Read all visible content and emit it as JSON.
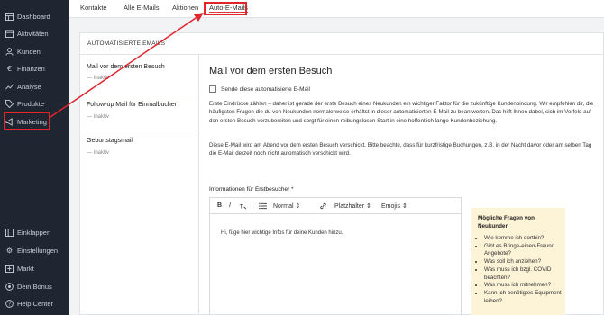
{
  "sidebar": {
    "items": [
      {
        "label": "Dashboard",
        "icon": "dashboard-icon"
      },
      {
        "label": "Aktivitäten",
        "icon": "activity-icon"
      },
      {
        "label": "Kunden",
        "icon": "users-icon"
      },
      {
        "label": "Finanzen",
        "icon": "euro-icon"
      },
      {
        "label": "Analyse",
        "icon": "chart-icon"
      },
      {
        "label": "Produkte",
        "icon": "tag-icon"
      },
      {
        "label": "Marketing",
        "icon": "megaphone-icon"
      }
    ],
    "bottom": [
      {
        "label": "Einklappen",
        "icon": "collapse-icon"
      },
      {
        "label": "Einstellungen",
        "icon": "gear-icon"
      },
      {
        "label": "Markt",
        "icon": "market-icon"
      },
      {
        "label": "Dein Bonus",
        "icon": "bonus-icon"
      },
      {
        "label": "Help Center",
        "icon": "help-icon"
      }
    ]
  },
  "tabs": [
    "Kontakte",
    "Alle E-Mails",
    "Aktionen",
    "Auto-E-Mails"
  ],
  "card": {
    "heading": "AUTOMATISIERTE EMAILS",
    "list": [
      {
        "title": "Mail vor dem ersten Besuch",
        "status": "Inaktiv"
      },
      {
        "title": "Follow-up Mail für Einmalbucher",
        "status": "Inaktiv"
      },
      {
        "title": "Geburtstagsmail",
        "status": "Inaktiv"
      }
    ]
  },
  "detail": {
    "title": "Mail vor dem ersten Besuch",
    "checkbox_label": "Sende diese automatisierte E-Mail",
    "para1": "Erste Eindrücke zählen – daher ist gerade der erste Besuch eines Neukunden ein wichtiger Faktor für die zukünftige Kundenbindung. Wir empfehlen dir, die häufigsten Fragen die du von Neukunden normalerweise erhältst in dieser automatisierten E-Mail zu beantworten. Das hilft Ihnen dabei, sich im Vorfeld auf den ersten Besuch vorzubereiten und sorgt für einen reibungslosen Start in eine hoffentlich lange Kundenbeziehung.",
    "para2": "Diese E-Mail wird am Abend vor dem ersten Besuch verschickt. Bitte beachte, dass für kurzfristige Buchungen, z.B. in der Nacht davor oder am selben Tag die E-Mail derzeit noch nicht automatisch verschickt wird.",
    "field_label": "Informationen für Erstbesucher *",
    "toolbar": {
      "bold": "B",
      "italic": "I",
      "format": "Normal",
      "placeholder": "Platzhalter",
      "emojis": "Emojis"
    },
    "editor_text": "Hi, füge hier wichtige Infos für deine Kunden hinzu.",
    "hint": {
      "title": "Mögliche Fragen von Neukunden",
      "items": [
        "Wie komme ich dorthin?",
        "Gibt es Bringe-einen-Freund Angebote?",
        "Was soll ich anziehen?",
        "Was muss ich bzgl. COVID beachten?",
        "Was muss ich mitnehmen?",
        "Kann ich benötigtes Equipment leihen?"
      ]
    }
  },
  "colors": {
    "sidebar": "#1f2631",
    "highlight": "#e0252d",
    "hint_bg": "#fdf3d7"
  }
}
